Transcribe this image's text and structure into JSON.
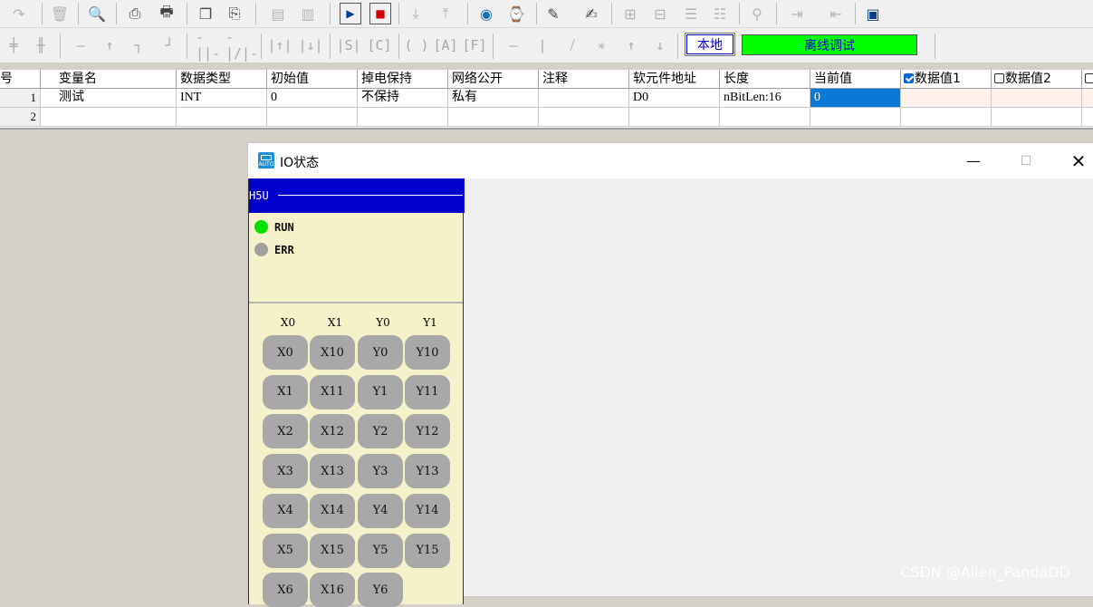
{
  "toolbar": {
    "local_label": "本地",
    "offline_label": "离线调试"
  },
  "table": {
    "headers": [
      "号",
      "变量名",
      "数据类型",
      "初始值",
      "掉电保持",
      "网络公开",
      "注释",
      "软元件地址",
      "长度",
      "当前值",
      "数据值1",
      "数据值2",
      ""
    ],
    "rows": [
      {
        "no": "1",
        "name": "测试",
        "type": "INT",
        "init": "0",
        "retain": "不保持",
        "network": "私有",
        "comment": "",
        "address": "D0",
        "length": "nBitLen:16",
        "current": "0",
        "v1": "",
        "v2": ""
      },
      {
        "no": "2",
        "name": "",
        "type": "",
        "init": "",
        "retain": "",
        "network": "",
        "comment": "",
        "address": "",
        "length": "",
        "current": "",
        "v1": "",
        "v2": ""
      }
    ]
  },
  "io_window": {
    "title": "IO状态",
    "icon_text": "AUTO",
    "model": "H5U",
    "status": [
      {
        "label": "RUN",
        "color": "#00e000"
      },
      {
        "label": "ERR",
        "color": "#a0a0a0"
      }
    ],
    "column_labels": [
      "X0",
      "X1",
      "Y0",
      "Y1"
    ],
    "io_grid": [
      [
        "X0",
        "X10",
        "Y0",
        "Y10"
      ],
      [
        "X1",
        "X11",
        "Y1",
        "Y11"
      ],
      [
        "X2",
        "X12",
        "Y2",
        "Y12"
      ],
      [
        "X3",
        "X13",
        "Y3",
        "Y13"
      ],
      [
        "X4",
        "X14",
        "Y4",
        "Y14"
      ],
      [
        "X5",
        "X15",
        "Y5",
        "Y15"
      ],
      [
        "X6",
        "X16",
        "Y6"
      ]
    ]
  },
  "watermark": "CSDN @Allen_PandaDD"
}
